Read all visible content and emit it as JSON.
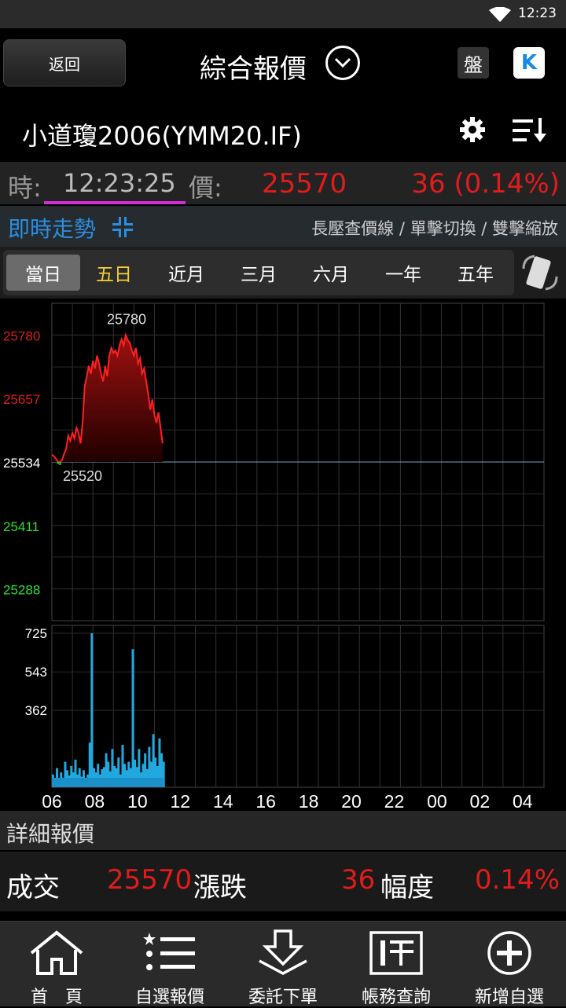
{
  "status": {
    "time": "12:23"
  },
  "header": {
    "back_label": "返回",
    "title": "綜合報價",
    "pan_label": "盤",
    "k_label": "K"
  },
  "stock": {
    "name": "小道瓊2006(YMM20.IF)"
  },
  "quote": {
    "time_label": "時:",
    "time": "12:23:25",
    "price_label": "價:",
    "price": "25570",
    "change": "36 (0.14%)"
  },
  "realtime": {
    "title": "即時走勢",
    "hint": "長壓查價線 / 單擊切換 / 雙擊縮放"
  },
  "tabs": [
    {
      "label": "當日"
    },
    {
      "label": "五日"
    },
    {
      "label": "近月"
    },
    {
      "label": "三月"
    },
    {
      "label": "六月"
    },
    {
      "label": "一年"
    },
    {
      "label": "五年"
    }
  ],
  "chart_data": {
    "type": "line",
    "price_yticks": [
      "25780",
      "25657",
      "25534",
      "25411",
      "25288"
    ],
    "price_ytick_colors": [
      "#e01c1c",
      "#e01c1c",
      "#ffffff",
      "#2ee02e",
      "#2ee02e"
    ],
    "reference_price": 25534,
    "high_label": "25780",
    "low_label": "25520",
    "volume_yticks": [
      "725",
      "543",
      "362"
    ],
    "xticks": [
      "06",
      "08",
      "10",
      "12",
      "14",
      "16",
      "18",
      "20",
      "22",
      "00",
      "02",
      "04"
    ],
    "price_series": [
      [
        0.0,
        25548
      ],
      [
        0.1,
        25545
      ],
      [
        0.2,
        25540
      ],
      [
        0.3,
        25530
      ],
      [
        0.4,
        25528
      ],
      [
        0.5,
        25538
      ],
      [
        0.6,
        25550
      ],
      [
        0.7,
        25560
      ],
      [
        0.8,
        25585
      ],
      [
        0.9,
        25575
      ],
      [
        1.0,
        25590
      ],
      [
        1.1,
        25580
      ],
      [
        1.2,
        25600
      ],
      [
        1.3,
        25590
      ],
      [
        1.4,
        25570
      ],
      [
        1.5,
        25610
      ],
      [
        1.6,
        25680
      ],
      [
        1.7,
        25700
      ],
      [
        1.8,
        25720
      ],
      [
        1.9,
        25705
      ],
      [
        2.0,
        25730
      ],
      [
        2.1,
        25715
      ],
      [
        2.2,
        25740
      ],
      [
        2.3,
        25725
      ],
      [
        2.4,
        25705
      ],
      [
        2.5,
        25690
      ],
      [
        2.6,
        25720
      ],
      [
        2.7,
        25700
      ],
      [
        2.8,
        25740
      ],
      [
        2.9,
        25755
      ],
      [
        3.0,
        25745
      ],
      [
        3.1,
        25750
      ],
      [
        3.2,
        25740
      ],
      [
        3.3,
        25760
      ],
      [
        3.4,
        25772
      ],
      [
        3.5,
        25760
      ],
      [
        3.6,
        25780
      ],
      [
        3.7,
        25770
      ],
      [
        3.8,
        25765
      ],
      [
        3.9,
        25750
      ],
      [
        4.0,
        25740
      ],
      [
        4.1,
        25755
      ],
      [
        4.2,
        25725
      ],
      [
        4.3,
        25735
      ],
      [
        4.4,
        25705
      ],
      [
        4.5,
        25715
      ],
      [
        4.6,
        25690
      ],
      [
        4.7,
        25665
      ],
      [
        4.8,
        25635
      ],
      [
        4.9,
        25655
      ],
      [
        5.0,
        25625
      ],
      [
        5.1,
        25610
      ],
      [
        5.2,
        25630
      ],
      [
        5.3,
        25600
      ],
      [
        5.4,
        25570
      ]
    ],
    "volume_series": [
      [
        0.05,
        60
      ],
      [
        0.15,
        40
      ],
      [
        0.25,
        90
      ],
      [
        0.35,
        30
      ],
      [
        0.45,
        70
      ],
      [
        0.55,
        45
      ],
      [
        0.65,
        120
      ],
      [
        0.75,
        80
      ],
      [
        0.85,
        55
      ],
      [
        0.95,
        100
      ],
      [
        1.05,
        70
      ],
      [
        1.15,
        130
      ],
      [
        1.25,
        60
      ],
      [
        1.35,
        90
      ],
      [
        1.45,
        50
      ],
      [
        1.55,
        80
      ],
      [
        1.65,
        40
      ],
      [
        1.75,
        60
      ],
      [
        1.85,
        210
      ],
      [
        1.95,
        725
      ],
      [
        2.05,
        90
      ],
      [
        2.15,
        70
      ],
      [
        2.25,
        110
      ],
      [
        2.35,
        60
      ],
      [
        2.45,
        85
      ],
      [
        2.55,
        95
      ],
      [
        2.65,
        160
      ],
      [
        2.75,
        120
      ],
      [
        2.85,
        75
      ],
      [
        2.95,
        180
      ],
      [
        3.05,
        100
      ],
      [
        3.15,
        90
      ],
      [
        3.25,
        140
      ],
      [
        3.35,
        60
      ],
      [
        3.45,
        200
      ],
      [
        3.55,
        110
      ],
      [
        3.65,
        80
      ],
      [
        3.75,
        120
      ],
      [
        3.85,
        90
      ],
      [
        3.95,
        650
      ],
      [
        4.05,
        130
      ],
      [
        4.15,
        95
      ],
      [
        4.25,
        180
      ],
      [
        4.35,
        70
      ],
      [
        4.45,
        110
      ],
      [
        4.55,
        160
      ],
      [
        4.65,
        85
      ],
      [
        4.75,
        190
      ],
      [
        4.85,
        120
      ],
      [
        4.95,
        250
      ],
      [
        5.05,
        140
      ],
      [
        5.15,
        100
      ],
      [
        5.25,
        230
      ],
      [
        5.35,
        160
      ],
      [
        5.45,
        120
      ]
    ]
  },
  "detail": {
    "title": "詳細報價",
    "trade_label": "成交",
    "trade_value": "25570",
    "change_label": "漲跌",
    "change_value": "36",
    "range_label": "幅度",
    "range_value": "0.14%"
  },
  "bottom_nav": [
    {
      "label": "首　頁",
      "icon": "home-icon"
    },
    {
      "label": "自選報價",
      "icon": "list-icon"
    },
    {
      "label": "委託下單",
      "icon": "order-icon"
    },
    {
      "label": "帳務查詢",
      "icon": "account-icon"
    },
    {
      "label": "新增自選",
      "icon": "add-icon"
    }
  ]
}
